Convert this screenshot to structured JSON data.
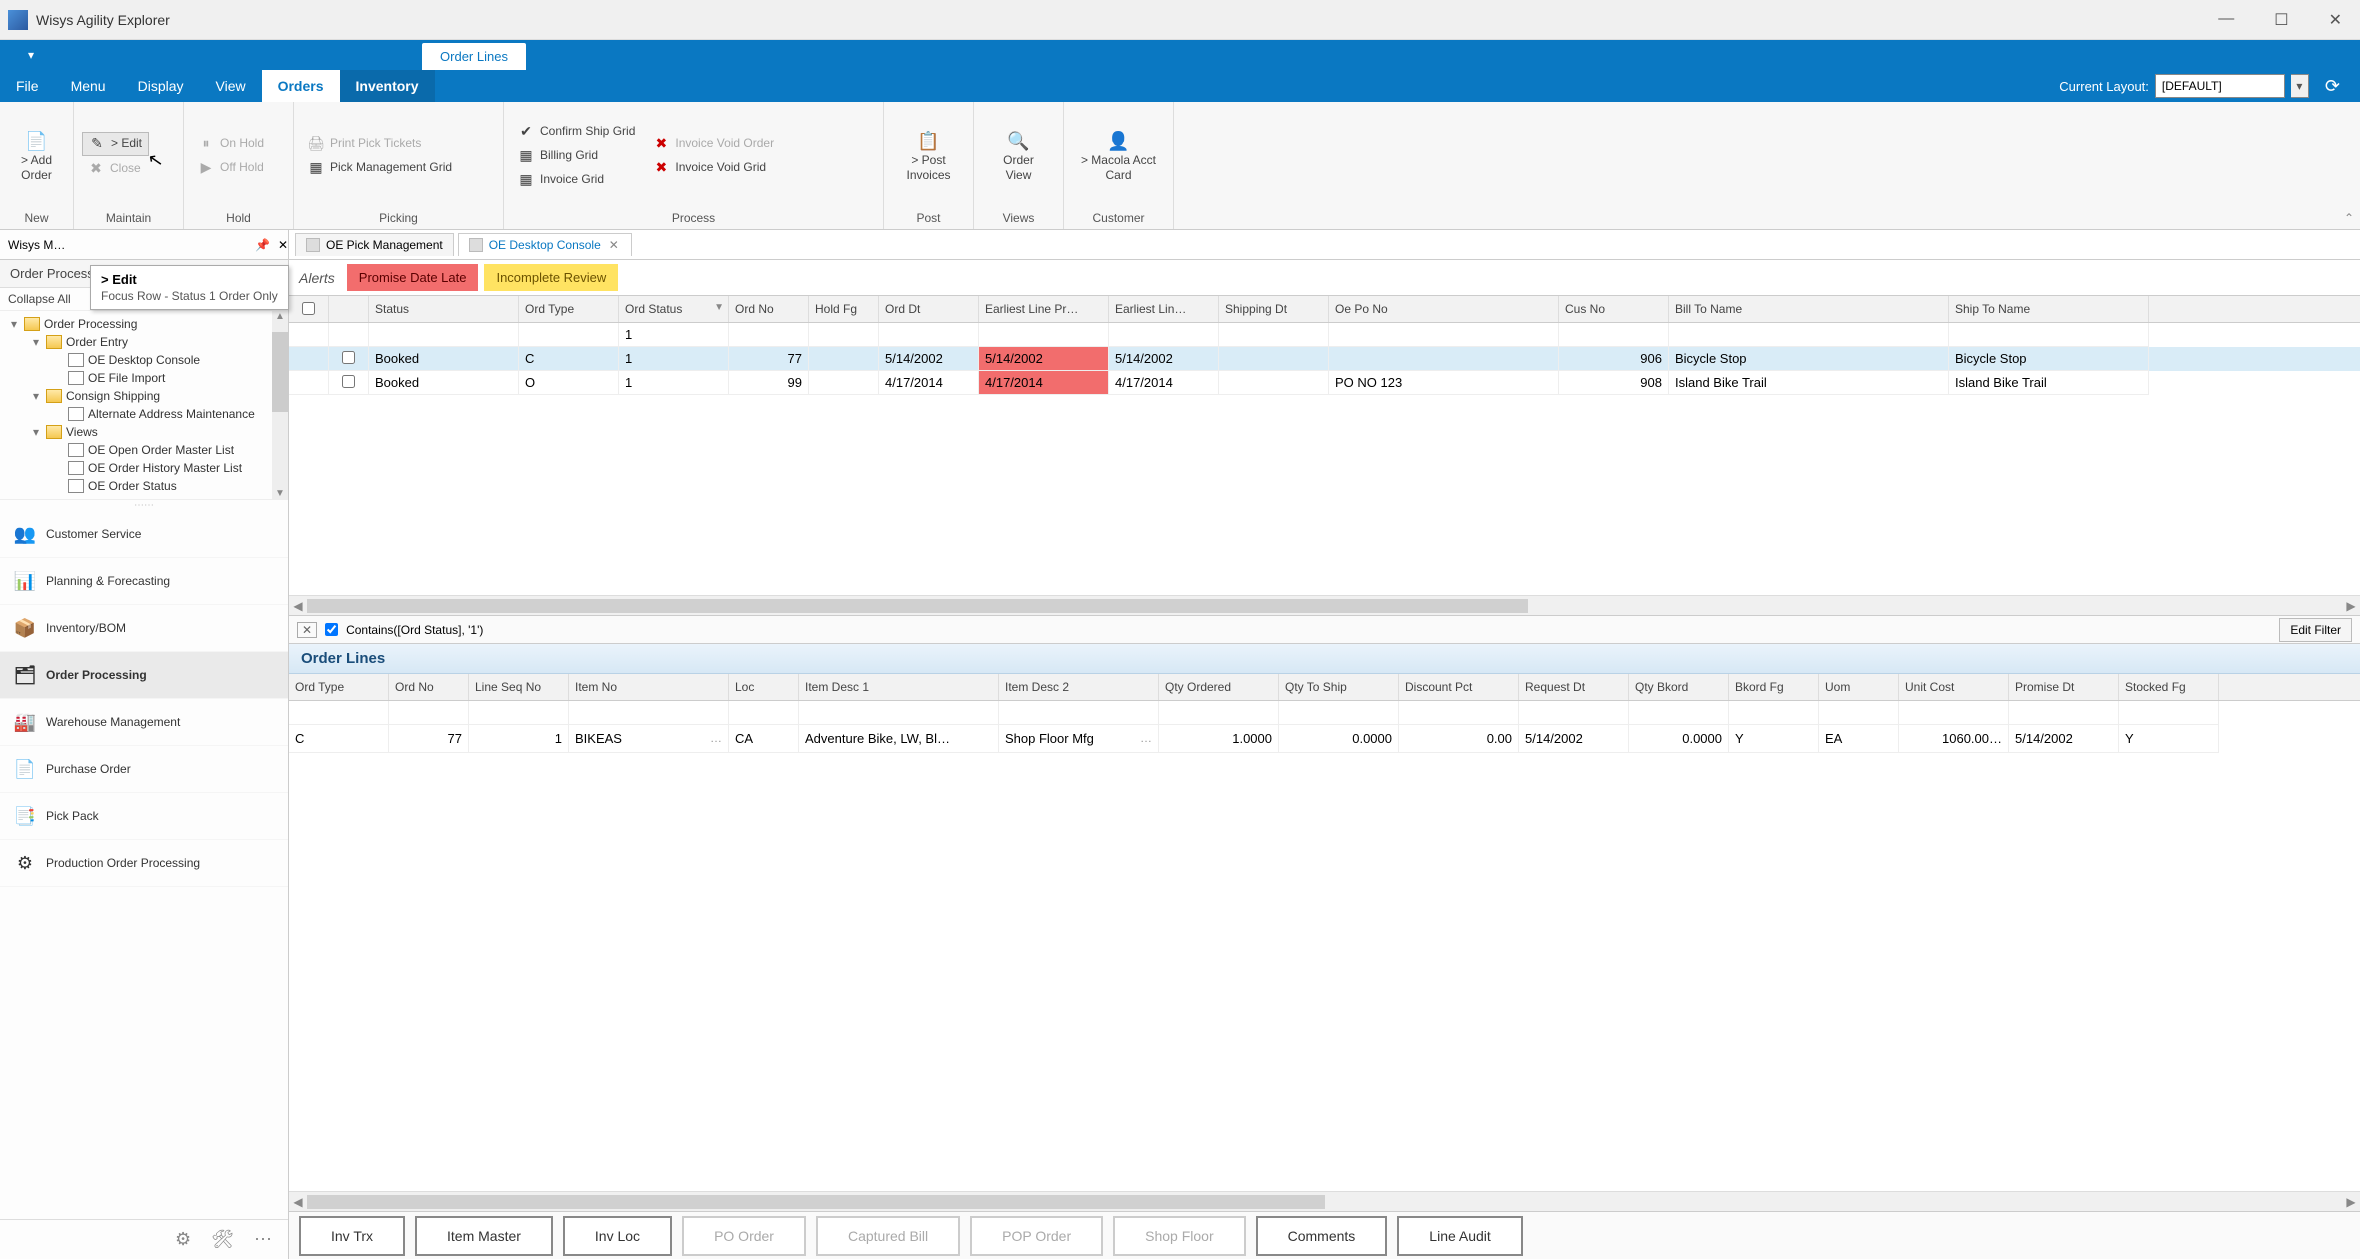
{
  "window": {
    "title": "Wisys Agility Explorer"
  },
  "context_tab": "Order Lines",
  "menu": {
    "items": [
      "File",
      "Menu",
      "Display",
      "View",
      "Orders",
      "Inventory"
    ],
    "active_index": 4,
    "highlight_index": 5,
    "layout_label": "Current Layout:",
    "layout_value": "[DEFAULT]"
  },
  "ribbon": {
    "groups": {
      "new": {
        "label": "New",
        "add_order": "> Add Order"
      },
      "maintain": {
        "label": "Maintain",
        "edit": "> Edit",
        "close": "Close"
      },
      "hold": {
        "label": "Hold",
        "on_hold": "On Hold",
        "off_hold": "Off Hold"
      },
      "picking": {
        "label": "Picking",
        "print_pick": "Print Pick Tickets",
        "pick_mgmt": "Pick Management Grid"
      },
      "process": {
        "label": "Process",
        "confirm_ship": "Confirm Ship Grid",
        "billing": "Billing Grid",
        "invoice": "Invoice Grid",
        "inv_void_order": "Invoice Void Order",
        "inv_void_grid": "Invoice Void Grid"
      },
      "post": {
        "label": "Post",
        "post_invoices": "> Post Invoices"
      },
      "views": {
        "label": "Views",
        "order_view": "Order View"
      },
      "customer": {
        "label": "Customer",
        "macola": "> Macola Acct Card"
      }
    }
  },
  "tooltip": {
    "title": "> Edit",
    "body": "Focus Row - Status 1 Order Only"
  },
  "doctabs": {
    "left_title": "Wisys M…",
    "tabs": [
      {
        "label": "OE Pick Management",
        "active": false
      },
      {
        "label": "OE Desktop Console",
        "active": true
      }
    ]
  },
  "sidebar": {
    "header": "Order Processing",
    "collapse": "Collapse All",
    "tree": [
      {
        "indent": 0,
        "exp": "▾",
        "ico": "folder",
        "label": "Order Processing"
      },
      {
        "indent": 1,
        "exp": "▾",
        "ico": "folder",
        "label": "Order Entry"
      },
      {
        "indent": 2,
        "exp": "",
        "ico": "doc",
        "label": "OE Desktop Console"
      },
      {
        "indent": 2,
        "exp": "",
        "ico": "doc",
        "label": "OE File Import"
      },
      {
        "indent": 1,
        "exp": "▾",
        "ico": "folder",
        "label": "Consign Shipping"
      },
      {
        "indent": 2,
        "exp": "",
        "ico": "doc",
        "label": "Alternate Address Maintenance"
      },
      {
        "indent": 1,
        "exp": "▾",
        "ico": "folder",
        "label": "Views"
      },
      {
        "indent": 2,
        "exp": "",
        "ico": "doc",
        "label": "OE Open Order Master List"
      },
      {
        "indent": 2,
        "exp": "",
        "ico": "doc",
        "label": "OE Order History Master List"
      },
      {
        "indent": 2,
        "exp": "",
        "ico": "doc",
        "label": "OE Order Status"
      }
    ],
    "nav": [
      {
        "icon": "👥",
        "label": "Customer Service"
      },
      {
        "icon": "📊",
        "label": "Planning & Forecasting"
      },
      {
        "icon": "📦",
        "label": "Inventory/BOM"
      },
      {
        "icon": "🗂",
        "label": "Order Processing",
        "active": true
      },
      {
        "icon": "🏭",
        "label": "Warehouse Management"
      },
      {
        "icon": "📄",
        "label": "Purchase Order"
      },
      {
        "icon": "📑",
        "label": "Pick Pack"
      },
      {
        "icon": "⚙",
        "label": "Production Order Processing"
      }
    ]
  },
  "alerts": {
    "label": "Alerts",
    "items": [
      {
        "text": "Promise Date Late",
        "cls": "alert-red"
      },
      {
        "text": "Incomplete Review",
        "cls": "alert-yel"
      }
    ]
  },
  "grid1": {
    "columns": [
      "",
      "",
      "Status",
      "Ord Type",
      "Ord Status",
      "Ord No",
      "Hold Fg",
      "Ord Dt",
      "Earliest Line Pr…",
      "Earliest Lin…",
      "Shipping Dt",
      "Oe Po No",
      "Cus No",
      "Bill To Name",
      "Ship To Name"
    ],
    "sort_col": 4,
    "filter_row": [
      "",
      "",
      "",
      "",
      "1",
      "",
      "",
      "",
      "",
      "",
      "",
      "",
      "",
      "",
      ""
    ],
    "rows": [
      {
        "cells": [
          "",
          "",
          "Booked",
          "C",
          "1",
          "77",
          "",
          "5/14/2002",
          "5/14/2002",
          "5/14/2002",
          "",
          "",
          "906",
          "Bicycle Stop",
          "Bicycle Stop"
        ],
        "selected": true,
        "red_cols": [
          8
        ]
      },
      {
        "cells": [
          "",
          "",
          "Booked",
          "O",
          "1",
          "99",
          "",
          "4/17/2014",
          "4/17/2014",
          "4/17/2014",
          "",
          "PO NO 123",
          "908",
          "Island Bike Trail",
          "Island Bike Trail"
        ],
        "selected": false,
        "red_cols": [
          8
        ]
      }
    ]
  },
  "filter_expr": "Contains([Ord Status], '1')",
  "edit_filter": "Edit Filter",
  "lines_header": "Order Lines",
  "grid2": {
    "columns": [
      "Ord Type",
      "Ord No",
      "Line Seq No",
      "Item No",
      "Loc",
      "Item Desc 1",
      "Item Desc 2",
      "Qty Ordered",
      "Qty To Ship",
      "Discount Pct",
      "Request Dt",
      "Qty Bkord",
      "Bkord Fg",
      "Uom",
      "Unit Cost",
      "Promise Dt",
      "Stocked Fg"
    ],
    "rows": [
      {
        "cells": [
          "C",
          "77",
          "1",
          "BIKEAS",
          "CA",
          "Adventure Bike, LW, Bl…",
          "Shop Floor Mfg",
          "1.0000",
          "0.0000",
          "0.00",
          "5/14/2002",
          "0.0000",
          "Y",
          "EA",
          "1060.00…",
          "5/14/2002",
          "Y"
        ]
      }
    ]
  },
  "bottom_buttons": [
    {
      "label": "Inv Trx",
      "enabled": true
    },
    {
      "label": "Item Master",
      "enabled": true
    },
    {
      "label": "Inv Loc",
      "enabled": true
    },
    {
      "label": "PO Order",
      "enabled": false
    },
    {
      "label": "Captured Bill",
      "enabled": false
    },
    {
      "label": "POP Order",
      "enabled": false
    },
    {
      "label": "Shop Floor",
      "enabled": false
    },
    {
      "label": "Comments",
      "enabled": true
    },
    {
      "label": "Line Audit",
      "enabled": true
    }
  ]
}
